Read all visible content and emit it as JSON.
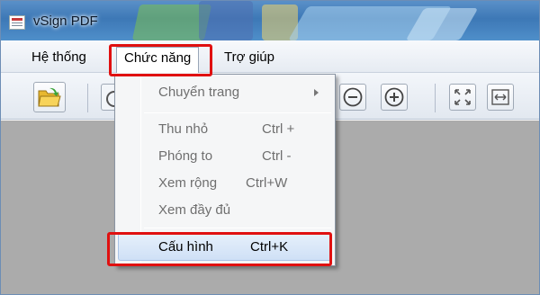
{
  "window": {
    "title": "vSign PDF"
  },
  "menubar": {
    "items": [
      {
        "label": "Hệ thống"
      },
      {
        "label": "Chức năng"
      },
      {
        "label": "Trợ giúp"
      }
    ]
  },
  "toolbar": {
    "buttons": [
      "open-folder-icon",
      "zoom-out-icon",
      "zoom-in-icon",
      "fit-page-icon",
      "fit-width-icon"
    ]
  },
  "dropdown": {
    "items": [
      {
        "label": "Chuyển trang",
        "shortcut": "",
        "submenu": true,
        "enabled": false
      },
      {
        "label": "Thu nhỏ",
        "shortcut": "Ctrl +",
        "enabled": false
      },
      {
        "label": "Phóng to",
        "shortcut": "Ctrl -",
        "enabled": false
      },
      {
        "label": "Xem rộng",
        "shortcut": "Ctrl+W",
        "enabled": false
      },
      {
        "label": "Xem đầy đủ",
        "shortcut": "",
        "enabled": false
      },
      {
        "label": "Cấu hình",
        "shortcut": "Ctrl+K",
        "enabled": true,
        "hovered": true
      }
    ]
  },
  "colors": {
    "highlight": "#e01010",
    "content_bg": "#ababab",
    "titlebar": "#3d78b6"
  }
}
